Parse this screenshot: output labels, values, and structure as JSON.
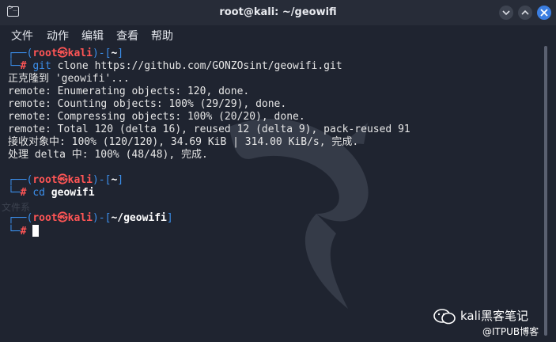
{
  "window": {
    "title": "root@kali: ~/geowifi",
    "accent": "#3b7ee1"
  },
  "menu": [
    "文件",
    "动作",
    "编辑",
    "查看",
    "帮助"
  ],
  "terminal": {
    "prompt1": {
      "user": "root",
      "at": "㉿",
      "host": "kali",
      "dir": "~",
      "hash": "#",
      "command": "git",
      "args": "clone https://github.com/GONZOsint/geowifi.git"
    },
    "output": [
      "正克隆到 'geowifi'...",
      "remote: Enumerating objects: 120, done.",
      "remote: Counting objects: 100% (29/29), done.",
      "remote: Compressing objects: 100% (20/20), done.",
      "remote: Total 120 (delta 16), reused 12 (delta 9), pack-reused 91",
      "接收对象中: 100% (120/120), 34.69 KiB | 314.00 KiB/s, 完成.",
      "处理 delta 中: 100% (48/48), 完成."
    ],
    "prompt2": {
      "user": "root",
      "at": "㉿",
      "host": "kali",
      "dir": "~",
      "hash": "#",
      "command": "cd",
      "args": "geowifi"
    },
    "prompt3": {
      "user": "root",
      "at": "㉿",
      "host": "kali",
      "dir": "~/geowifi",
      "hash": "#"
    },
    "colors": {
      "bracket": "#3b8eea",
      "user": "#ff5555",
      "text": "#e6e6e6"
    }
  },
  "background_label": "文件系",
  "watermark": {
    "main": "kali黑客笔记",
    "sub": "@ITPUB博客"
  }
}
